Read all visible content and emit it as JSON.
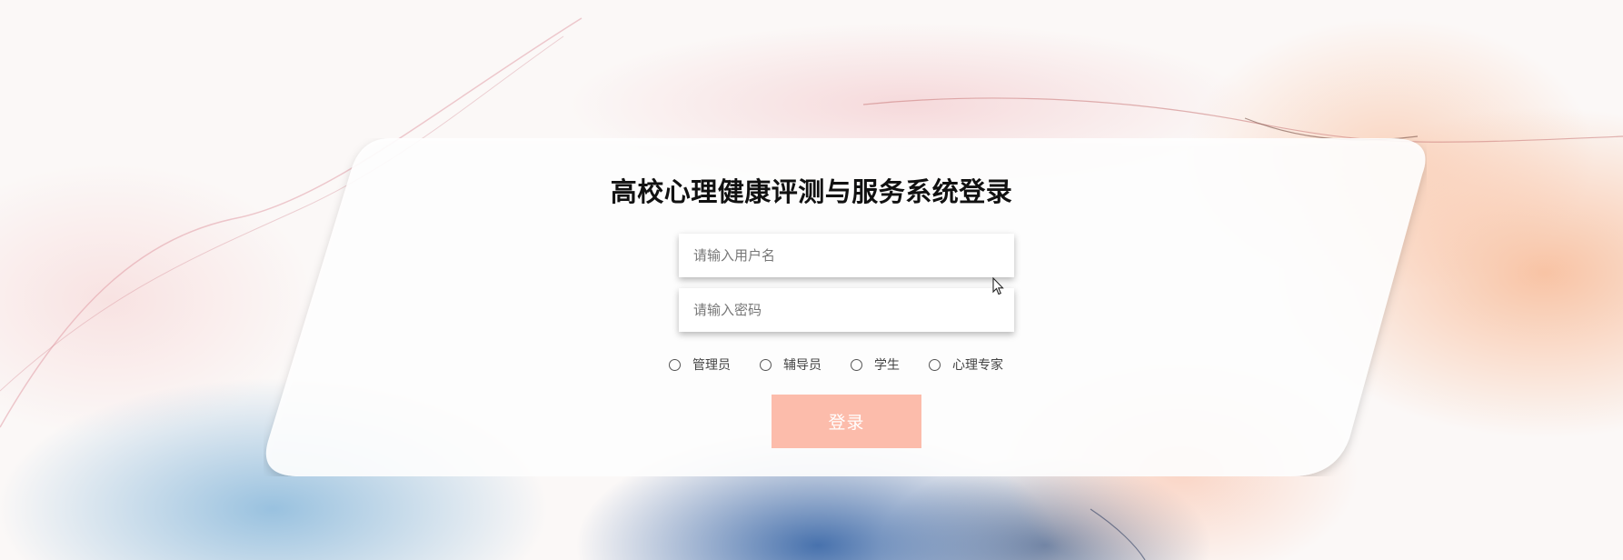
{
  "login": {
    "title": "高校心理健康评测与服务系统登录",
    "username_placeholder": "请输入用户名",
    "password_placeholder": "请输入密码",
    "username_value": "",
    "password_value": "",
    "roles": [
      "管理员",
      "辅导员",
      "学生",
      "心理专家"
    ],
    "submit_label": "登录"
  },
  "colors": {
    "button": "#fcbcab",
    "title": "#111111",
    "card": "#ffffff"
  },
  "icons": [
    "radio-unchecked-icon",
    "mouse-cursor-icon"
  ]
}
